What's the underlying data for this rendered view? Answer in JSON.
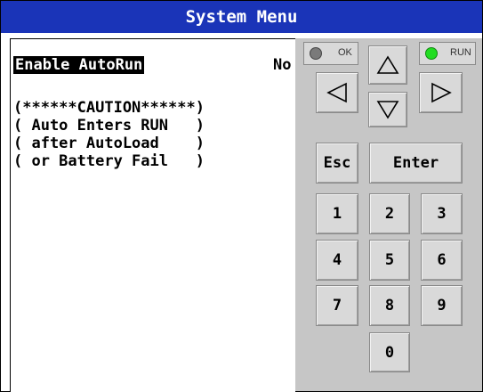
{
  "title": "System Menu",
  "screen": {
    "option_label": "Enable AutoRun",
    "option_value": "No",
    "caution_lines": [
      "(******CAUTION******)",
      "( Auto Enters RUN   )",
      "( after AutoLoad    )",
      "( or Battery Fail   )"
    ]
  },
  "indicators": {
    "ok": {
      "label": "OK",
      "color": "#7a7a7a"
    },
    "run": {
      "label": "RUN",
      "color": "#22dd22"
    }
  },
  "keys": {
    "esc": "Esc",
    "enter": "Enter",
    "digits": [
      "1",
      "2",
      "3",
      "4",
      "5",
      "6",
      "7",
      "8",
      "9",
      "0"
    ]
  },
  "colors": {
    "titlebar": "#1a34b8",
    "keypad_bg": "#c6c6c6"
  }
}
